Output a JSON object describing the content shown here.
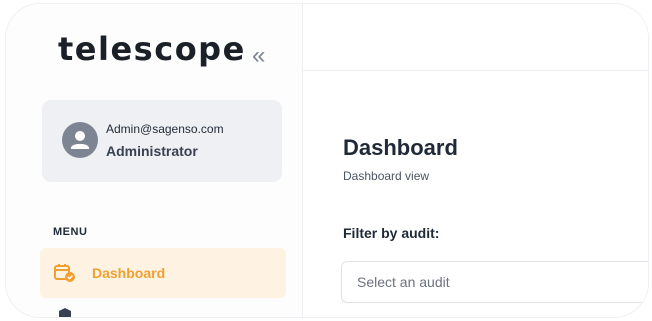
{
  "app": {
    "logo_text": "telescope",
    "collapse_icon": "double-chevron-left-icon"
  },
  "user": {
    "email": "Admin@sagenso.com",
    "role": "Administrator",
    "avatar_icon": "user-icon"
  },
  "menu": {
    "heading": "MENU",
    "items": [
      {
        "label": "Dashboard",
        "icon": "calendar-icon",
        "active": true
      },
      {
        "label": "",
        "icon": "shield-icon",
        "active": false
      }
    ]
  },
  "main": {
    "title": "Dashboard",
    "subtitle": "Dashboard view",
    "filter": {
      "label": "Filter by audit:",
      "placeholder": "Select an audit"
    }
  },
  "colors": {
    "accent": "#f0a030",
    "accent_bg": "#fef3e2",
    "card_bg": "#eef0f3"
  }
}
